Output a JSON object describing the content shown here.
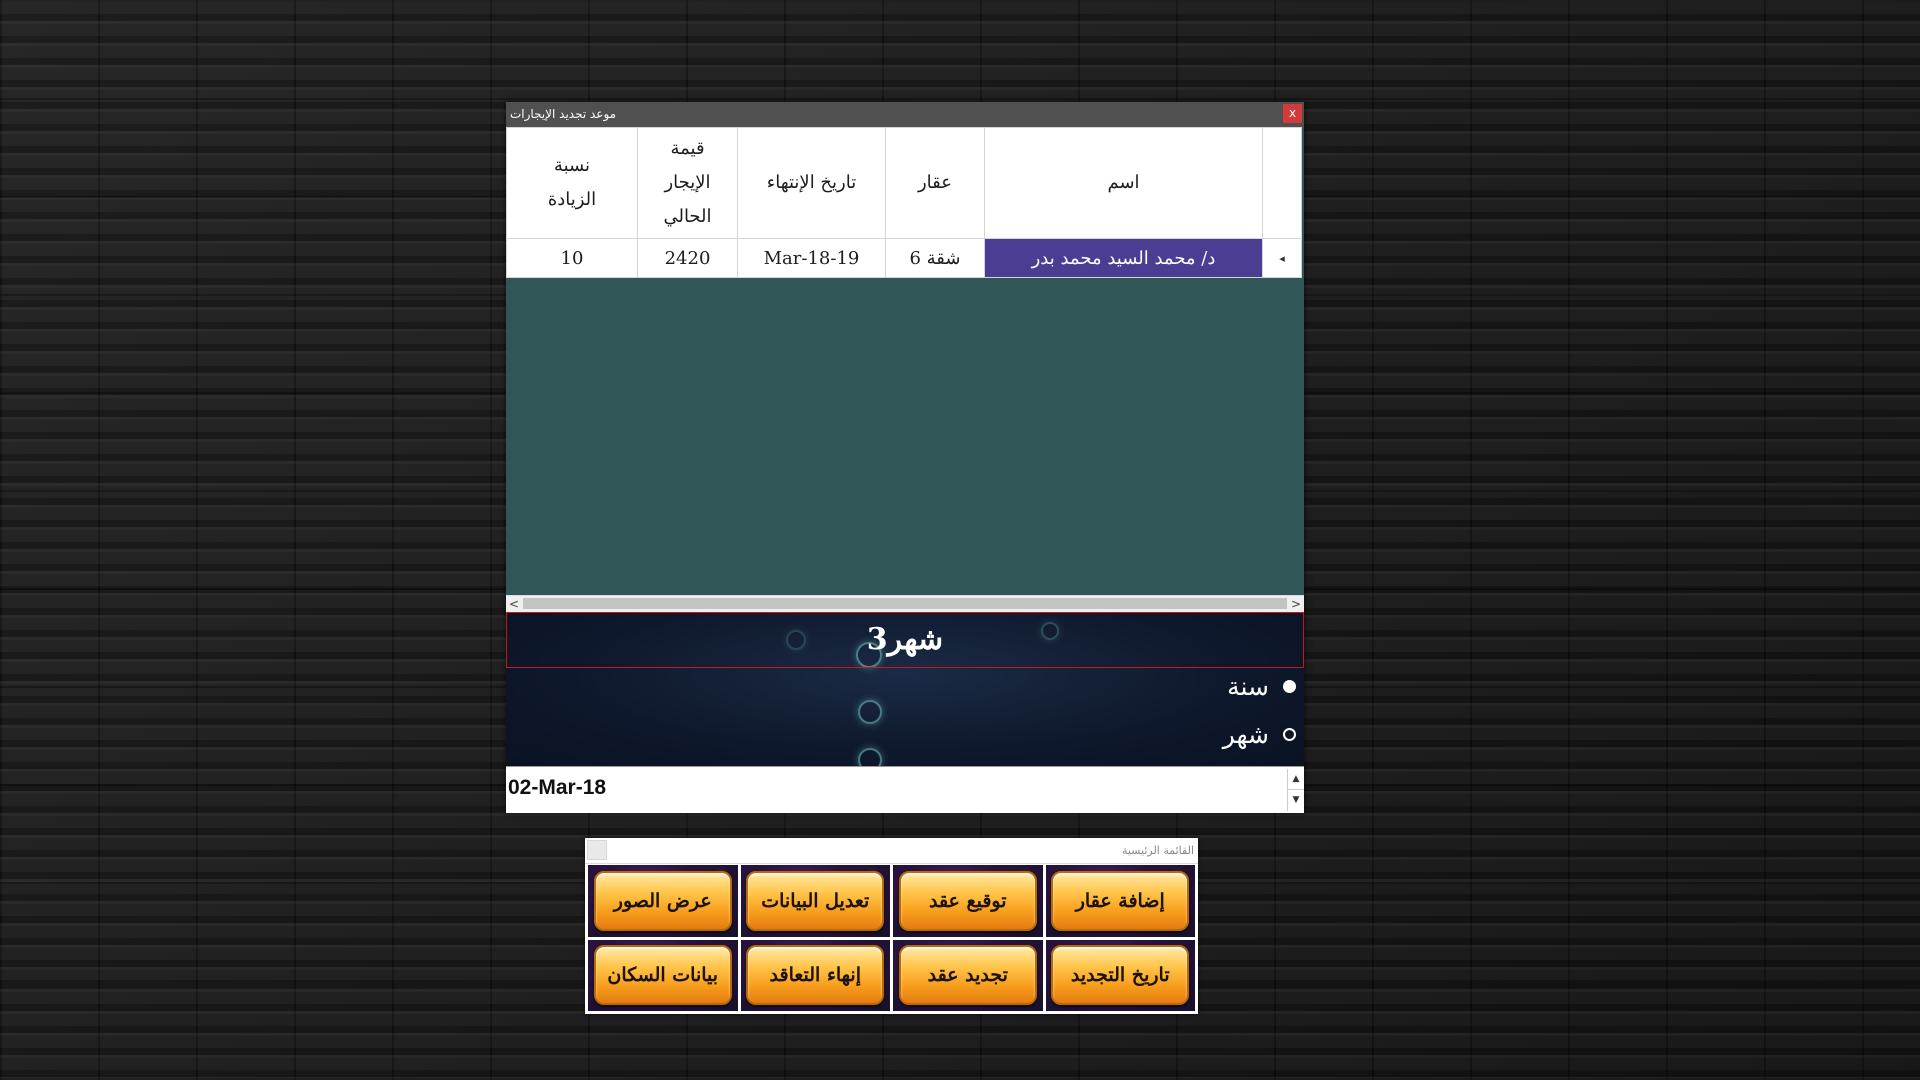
{
  "window": {
    "title": "موعد تجديد الإيجارات",
    "close_label": "x"
  },
  "grid": {
    "columns": [
      "اسم",
      "عقار",
      "تاريخ الإنتهاء",
      "قيمة الإيجار الحالي",
      "نسبة الزيادة"
    ],
    "row_indicator": "◂",
    "rows": [
      [
        "د/ محمد السيد محمد بدر",
        "شقة 6",
        "Mar-18-19",
        "2420",
        "10"
      ]
    ]
  },
  "period": {
    "display": "3شهر",
    "options": [
      {
        "label": "سنة",
        "selected": true
      },
      {
        "label": "شهر",
        "selected": false
      }
    ]
  },
  "date_field": {
    "value": "02-Mar-18",
    "spin_up": "▲",
    "spin_down": "▼"
  },
  "scroll": {
    "left": "<",
    "right": ">"
  },
  "menu": {
    "title": "القائمة الرئيسية",
    "buttons": [
      "إضافة عقار",
      "توقيع عقد",
      "تعديل البيانات",
      "عرض الصور",
      "تاريخ التجديد",
      "تجديد عقد",
      "إنهاء التعاقد",
      "بيانات السكان"
    ]
  },
  "colors": {
    "selected_cell": "#4b3d91",
    "grid_background": "#305657",
    "period_border": "#c8181c",
    "button_gold": "#f7a51f",
    "close_button": "#d33a3a"
  }
}
